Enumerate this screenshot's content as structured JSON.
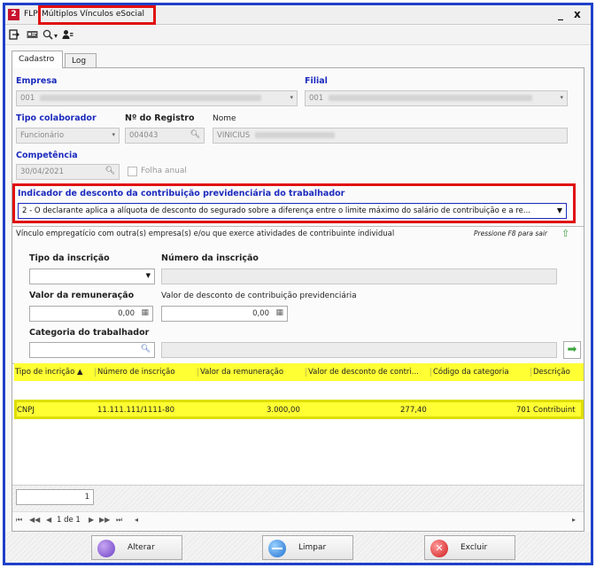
{
  "window": {
    "logo_letter": "2",
    "app_name": "FLP",
    "title": "Múltiplos Vínculos eSocial",
    "minimize": "_",
    "close": "x"
  },
  "toolbar": {
    "icons": [
      "exit-icon",
      "id-card-icon",
      "search-icon",
      "user-icon"
    ],
    "dropdown_arrow": "▾"
  },
  "tabs": [
    "Cadastro",
    "Log"
  ],
  "form": {
    "empresa_label": "Empresa",
    "empresa_value": "001",
    "filial_label": "Filial",
    "filial_value": "001",
    "tipo_colab_label": "Tipo colaborador",
    "tipo_colab_value": "Funcionário",
    "registro_label": "Nº do Registro",
    "registro_value": "004043",
    "nome_label": "Nome",
    "nome_value": "VINICIUS",
    "competencia_label": "Competência",
    "competencia_value": "30/04/2021",
    "folha_anual_label": "Folha anual",
    "indicador_label": "Indicador de desconto da contribuição previdenciária do trabalhador",
    "indicador_value": "2 - O declarante aplica a alíquota de desconto do segurado sobre a diferença entre o limite máximo do salário de contribuição e a re..."
  },
  "vinculo": {
    "header": "Vínculo empregatício com outra(s) empresa(s) e/ou que exerce atividades de contribuinte individual",
    "f8_hint": "Pressione F8 para sair",
    "tipo_inscricao_label": "Tipo da inscrição",
    "tipo_inscricao_value": "",
    "numero_inscricao_label": "Número da inscrição",
    "valor_remuneracao_label": "Valor da remuneração",
    "valor_remuneracao_value": "0,00",
    "valor_desconto_label": "Valor de desconto de contribuição previdenciária",
    "valor_desconto_value": "0,00",
    "categoria_label": "Categoria do trabalhador"
  },
  "grid": {
    "columns": [
      "Tipo de incrição ▲",
      "Número de inscrição",
      "Valor da remuneração",
      "Valor de desconto de contri...",
      "Código da categoria",
      "Descrição"
    ],
    "rows": [
      [
        "CNPJ",
        "11.111.111/1111-80",
        "3.000,00",
        "277,40",
        "701",
        "Contribuint"
      ]
    ],
    "record_count": "1",
    "pager_text": "1 de 1"
  },
  "buttons": {
    "alterar": "Alterar",
    "limpar": "Limpar",
    "excluir": "Excluir"
  },
  "colors": {
    "window_border": "#1f3fc9",
    "highlight_red": "#e01010",
    "highlight_yellow": "#ffff33",
    "label_blue": "#1c2bbd"
  }
}
